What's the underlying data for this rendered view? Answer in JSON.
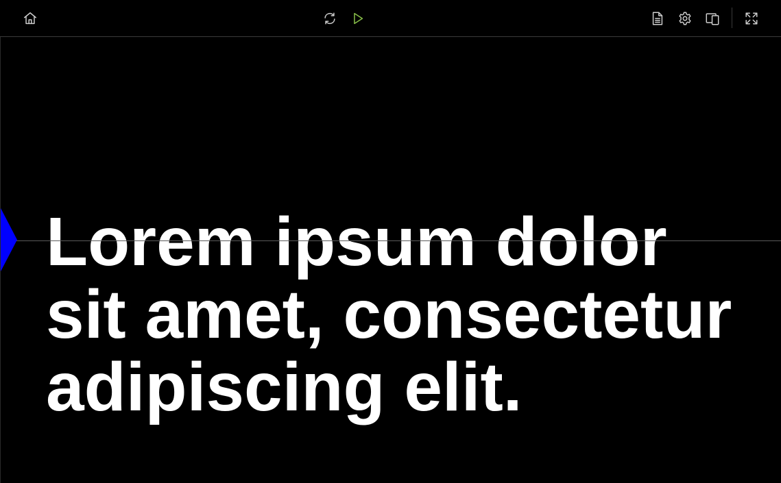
{
  "toolbar": {
    "left": [
      {
        "icon": "home-icon"
      }
    ],
    "center": [
      {
        "icon": "refresh-icon"
      },
      {
        "icon": "play-icon",
        "color": "#8bc34a"
      }
    ],
    "right": [
      {
        "icon": "document-icon"
      },
      {
        "icon": "gear-icon"
      },
      {
        "icon": "external-display-icon"
      },
      {
        "icon": "fullscreen-icon"
      }
    ]
  },
  "stage": {
    "text": "Lorem ipsum dolor sit amet, consectetur adipiscing elit.",
    "text_color": "#ffffff",
    "background": "#000000",
    "marker_color": "#0000ff"
  }
}
